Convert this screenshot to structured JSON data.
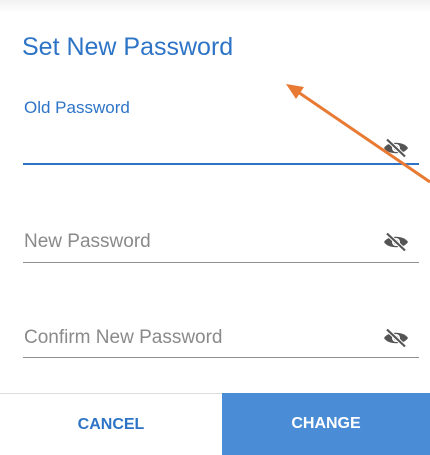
{
  "dialog": {
    "title": "Set New Password"
  },
  "fields": {
    "old_password": {
      "label": "Old Password",
      "value": ""
    },
    "new_password": {
      "placeholder": "New Password",
      "value": ""
    },
    "confirm_password": {
      "placeholder": "Confirm New Password",
      "value": ""
    }
  },
  "buttons": {
    "cancel_label": "CANCEL",
    "change_label": "CHANGE"
  },
  "icons": {
    "visibility_toggle": "eye-off-icon",
    "annotation": "arrow-annotation"
  },
  "colors": {
    "accent": "#2e74c6",
    "button_primary": "#4a8cd6",
    "annotation_arrow": "#e87a33"
  }
}
